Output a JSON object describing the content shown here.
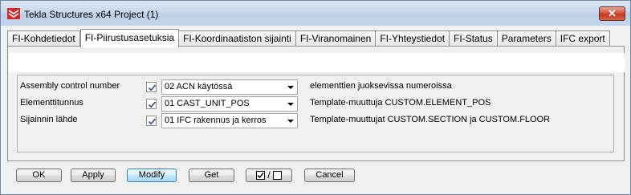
{
  "window": {
    "title": "Tekla Structures x64  Project (1)",
    "close_glyph": "✕",
    "close_color": "#c23a24"
  },
  "tabs": [
    {
      "label": "FI-Kohdetiedot",
      "active": false
    },
    {
      "label": "FI-Piirustusasetuksia",
      "active": true
    },
    {
      "label": "FI-Koordinaatiston sijainti",
      "active": false
    },
    {
      "label": "FI-Viranomainen",
      "active": false
    },
    {
      "label": "FI-Yhteystiedot",
      "active": false
    },
    {
      "label": "FI-Status",
      "active": false
    },
    {
      "label": "Parameters",
      "active": false
    },
    {
      "label": "IFC export",
      "active": false
    }
  ],
  "rows": [
    {
      "label": "Assembly control number",
      "checked": true,
      "value": "02 ACN käytössä",
      "note": "elementtien juoksevissa numeroissa"
    },
    {
      "label": "Elementtitunnus",
      "checked": true,
      "value": "01 CAST_UNIT_POS",
      "note": "Template-muuttuja CUSTOM.ELEMENT_POS"
    },
    {
      "label": "Sijainnin lähde",
      "checked": true,
      "value": "01 IFC rakennus ja kerros",
      "note": "Template-muuttujat CUSTOM.SECTION ja CUSTOM.FLOOR"
    }
  ],
  "buttons": {
    "ok": "OK",
    "apply": "Apply",
    "modify": "Modify",
    "get": "Get",
    "toggle_slash": "/",
    "cancel": "Cancel"
  },
  "colors": {
    "check_mark": "#4a5a8c",
    "accent_button": "#3c7fb1"
  }
}
